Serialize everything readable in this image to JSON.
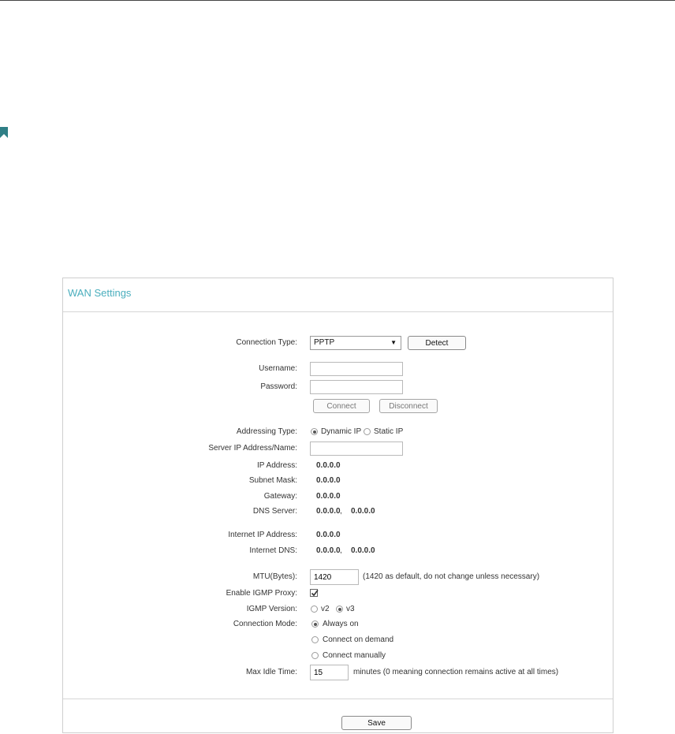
{
  "panel": {
    "title": "WAN Settings"
  },
  "connection_type": {
    "label": "Connection Type:",
    "value": "PPTP",
    "detect_label": "Detect"
  },
  "username": {
    "label": "Username:",
    "value": ""
  },
  "password": {
    "label": "Password:",
    "value": ""
  },
  "session_buttons": {
    "connect": "Connect",
    "disconnect": "Disconnect"
  },
  "addressing": {
    "label": "Addressing Type:",
    "dynamic": "Dynamic IP",
    "static": "Static IP",
    "selected": "Dynamic IP"
  },
  "server": {
    "label": "Server IP Address/Name:",
    "value": ""
  },
  "ip": {
    "label": "IP Address:",
    "value": "0.0.0.0"
  },
  "subnet": {
    "label": "Subnet Mask:",
    "value": "0.0.0.0"
  },
  "gateway": {
    "label": "Gateway:",
    "value": "0.0.0.0"
  },
  "dns": {
    "label": "DNS Server:",
    "primary": "0.0.0.0",
    "secondary": "0.0.0.0",
    "sep": ","
  },
  "internet_ip": {
    "label": "Internet IP Address:",
    "value": "0.0.0.0"
  },
  "internet_dns": {
    "label": "Internet DNS:",
    "primary": "0.0.0.0",
    "secondary": "0.0.0.0",
    "sep": ","
  },
  "mtu": {
    "label": "MTU(Bytes):",
    "value": "1420",
    "note": "(1420 as default, do not change unless necessary)"
  },
  "igmp_proxy": {
    "label": "Enable IGMP Proxy:",
    "checked": true
  },
  "igmp_version": {
    "label": "IGMP Version:",
    "v2": "v2",
    "v3": "v3",
    "selected": "v3"
  },
  "connection_mode": {
    "label": "Connection Mode:",
    "options": [
      "Always on",
      "Connect on demand",
      "Connect manually"
    ],
    "selected": "Always on"
  },
  "max_idle": {
    "label": "Max Idle Time:",
    "value": "15",
    "note": "minutes (0 meaning connection remains active at all times)"
  },
  "footer": {
    "save_label": "Save"
  },
  "colors": {
    "accent": "#4aaebd",
    "bookmark": "#2f7f86"
  }
}
